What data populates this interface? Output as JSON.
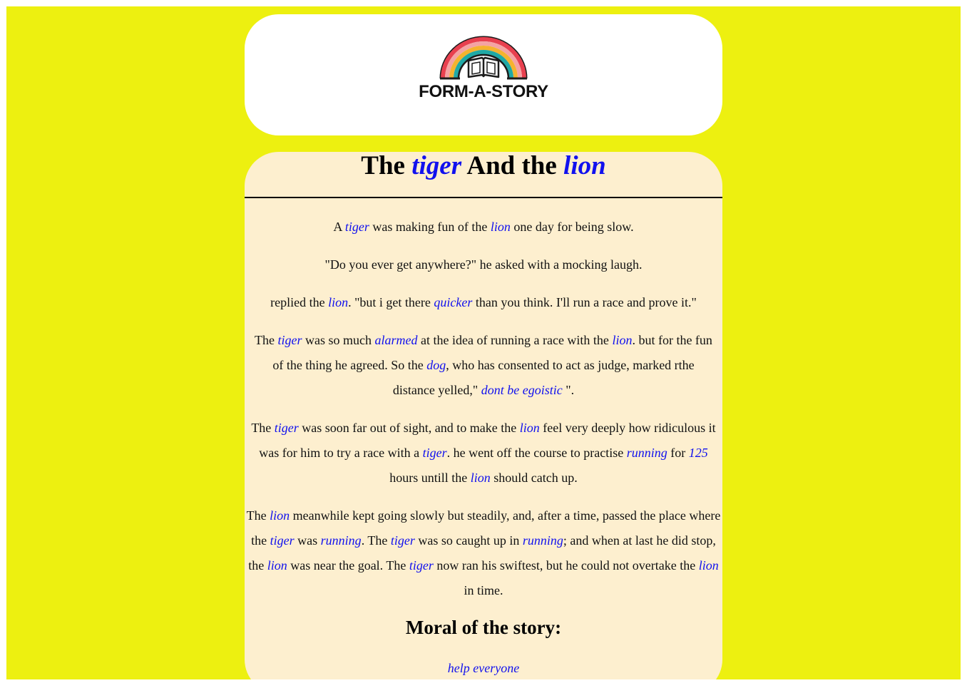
{
  "logo": {
    "text": "FORM-A-STORY",
    "icon": "rainbow-book-icon",
    "colors": [
      "#e8404f",
      "#f4a3a3",
      "#f5b32f",
      "#20a9a6",
      "#1c1c1c"
    ]
  },
  "title": {
    "w1": "The",
    "v1": "tiger",
    "w2": "And the",
    "v2": "lion"
  },
  "p1": {
    "t1": "A",
    "v1": "tiger",
    "t2": "was making fun of the",
    "v2": "lion",
    "t3": "one day for being slow."
  },
  "p2": {
    "t1": "\"Do you ever get anywhere?\" he asked with a mocking laugh."
  },
  "p3": {
    "t1": "replied the",
    "v1": "lion",
    "t2": ". \"but i get there",
    "v2": "quicker",
    "t3": "than you think. I'll run a race and prove it.\""
  },
  "p4": {
    "t1": "The",
    "v1": "tiger",
    "t2": "was so much",
    "v2": "alarmed",
    "t3": "at the idea of running a race with the",
    "v3": "lion",
    "t4": ". but for the fun of the thing he agreed. So the",
    "v4": "dog",
    "t5": ", who has consented to act as judge, marked rthe distance yelled,\"",
    "v5": "dont be egoistic",
    "t6": "\"."
  },
  "p5": {
    "t1": "The",
    "v1": "tiger",
    "t2": "was soon far out of sight, and to make the",
    "v2": "lion",
    "t3": "feel very deeply how ridiculous it was for him to try a race with a",
    "v3": "tiger",
    "t4": ". he went off the course to practise",
    "v4": "running",
    "t5": "for",
    "v5": "125",
    "t6": "hours untill the",
    "v6": "lion",
    "t7": "should catch up."
  },
  "p6": {
    "t1": "The",
    "v1": "lion",
    "t2": "meanwhile kept going slowly but steadily, and, after a time, passed the place where the",
    "v2": "tiger",
    "t3": "was",
    "v3": "running",
    "t4": ". The",
    "v4": "tiger",
    "t5": "was so caught up in",
    "v5": "running",
    "t6": "; and when at last he did stop, the",
    "v6": "lion",
    "t7": "was near the goal. The",
    "v7": "tiger",
    "t8": "now ran his swiftest, but he could not overtake the",
    "v8": "lion",
    "t9": "in time."
  },
  "moral": {
    "heading": "Moral of the story:",
    "text": "help everyone"
  },
  "colors": {
    "background": "#edf010",
    "card": "#fdefcf",
    "variable": "#1111ee"
  }
}
